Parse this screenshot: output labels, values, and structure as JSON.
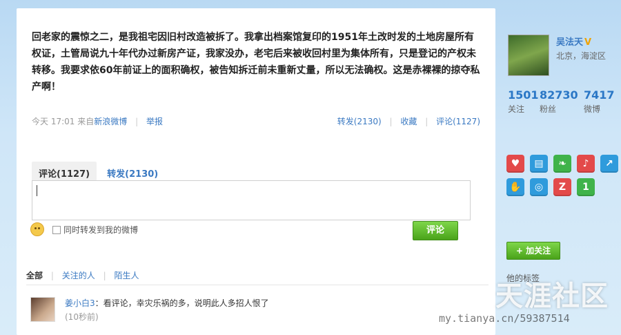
{
  "post": {
    "text": "回老家的震惊之二，是我祖宅因旧村改造被拆了。我拿出档案馆复印的1951年土改时发的土地房屋所有权证，土管局说九十年代办过新房产证，我家没办，老宅后来被收回村里为集体所有，只是登记的产权未转移。我要求依60年前证上的面积确权，被告知拆迁前未重新丈量，所以无法确权。这是赤裸裸的掠夺私产啊！",
    "time": "今天 17:01",
    "source_prefix": "来自",
    "source": "新浪微博",
    "report": "举报",
    "forward": "转发(2130)",
    "favorite": "收藏",
    "comment": "评论(1127)"
  },
  "tabs": {
    "comments": "评论(1127)",
    "reposts": "转发(2130)"
  },
  "composer": {
    "placeholder": "",
    "forward_checkbox_label": "同时转发到我的微博",
    "submit_label": "评论"
  },
  "filters": {
    "all": "全部",
    "following": "关注的人",
    "strangers": "陌生人"
  },
  "comment_list": [
    {
      "user": "姜小白3",
      "text": "：看评论，幸灾乐祸的多，说明此人多招人恨了",
      "time": "(10秒前)"
    }
  ],
  "profile": {
    "name": "吴法天",
    "verified_badge": "V",
    "location": "北京，海淀区",
    "stats": [
      {
        "num": "1501",
        "label": "关注"
      },
      {
        "num": "82730",
        "label": "粉丝"
      },
      {
        "num": "7417",
        "label": "微博"
      }
    ],
    "follow_label": "+ 加关注",
    "tags_label": "他的标签"
  },
  "badges": [
    {
      "icon": "heart-badge-icon",
      "glyph": "♥",
      "color": "#e34a4a"
    },
    {
      "icon": "book-badge-icon",
      "glyph": "▤",
      "color": "#2f9bdc"
    },
    {
      "icon": "leaf-badge-icon",
      "glyph": "❧",
      "color": "#3fb34a"
    },
    {
      "icon": "mic-badge-icon",
      "glyph": "♪",
      "color": "#e34a4a"
    },
    {
      "icon": "arrow-badge-icon",
      "glyph": "↗",
      "color": "#2f9bdc"
    },
    {
      "icon": "hand-badge-icon",
      "glyph": "✋",
      "color": "#2f9bdc"
    },
    {
      "icon": "search-badge-icon",
      "glyph": "◎",
      "color": "#2f9bdc"
    },
    {
      "icon": "z-badge-icon",
      "glyph": "Z",
      "color": "#e34a4a"
    },
    {
      "icon": "number-badge-icon",
      "glyph": "1",
      "color": "#3fb34a"
    }
  ],
  "watermark": {
    "logo": "天涯社区",
    "url": "my.tianya.cn/59387514"
  },
  "colors": {
    "link": "#3a79c2",
    "stat_number": "#2a77c6",
    "button_green": "#4aa31a"
  }
}
